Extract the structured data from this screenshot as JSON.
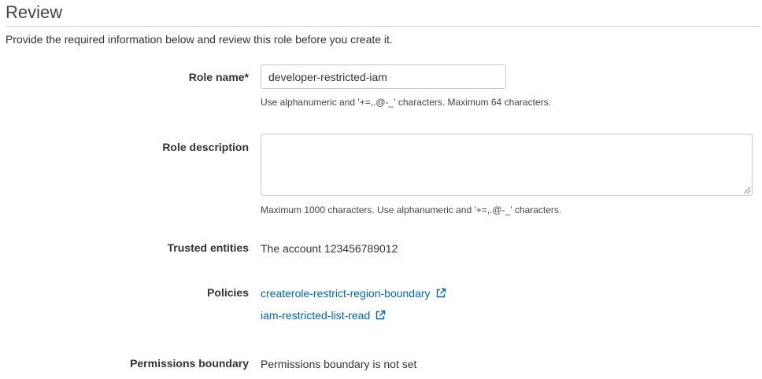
{
  "header": {
    "title": "Review",
    "intro": "Provide the required information below and review this role before you create it."
  },
  "role_name": {
    "label": "Role name*",
    "value": "developer-restricted-iam",
    "hint": "Use alphanumeric and '+=,.@-_' characters. Maximum 64 characters."
  },
  "role_description": {
    "label": "Role description",
    "value": "",
    "hint": "Maximum 1000 characters. Use alphanumeric and '+=,.@-_' characters."
  },
  "trusted_entities": {
    "label": "Trusted entities",
    "value": "The account 123456789012"
  },
  "policies": {
    "label": "Policies",
    "items": [
      {
        "name": "createrole-restrict-region-boundary",
        "icon": "external-link-icon"
      },
      {
        "name": "iam-restricted-list-read",
        "icon": "external-link-icon"
      }
    ]
  },
  "permissions_boundary": {
    "label": "Permissions boundary",
    "value": "Permissions boundary is not set"
  },
  "colors": {
    "link": "#0066aa",
    "text": "#333333",
    "border": "#c8c8c8"
  }
}
